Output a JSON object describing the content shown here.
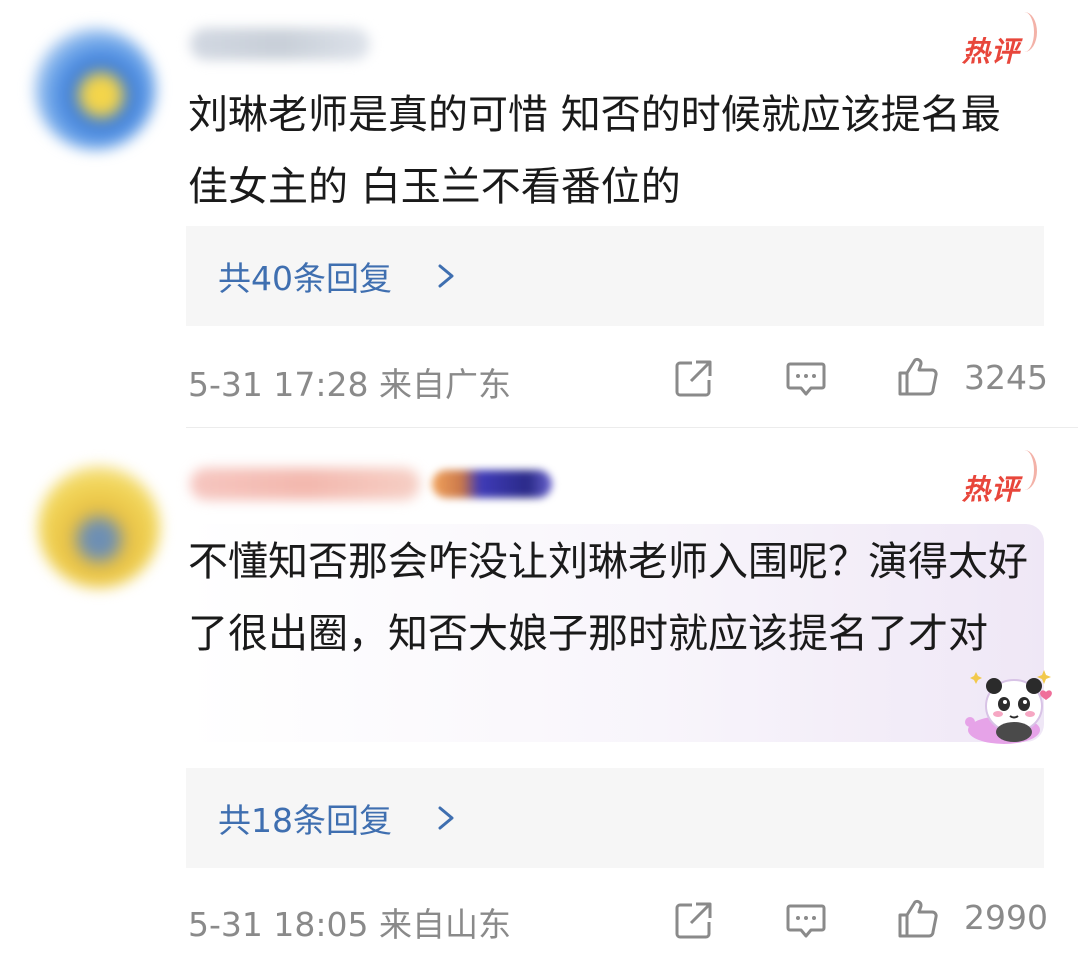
{
  "comments": [
    {
      "badge": "热评",
      "text": "刘琳老师是真的可惜 知否的时候就应该提名最佳女主的 白玉兰不看番位的",
      "replies_label": "共40条回复",
      "timestamp": "5-31 17:28",
      "location": "来自广东",
      "likes": "3245",
      "icons": [
        "share-icon",
        "comment-icon",
        "like-icon",
        "chevron-right-icon"
      ]
    },
    {
      "badge": "热评",
      "text": "不懂知否那会咋没让刘琳老师入围呢？演得太好了很出圈，知否大娘子那时就应该提名了才对",
      "replies_label": "共18条回复",
      "timestamp": "5-31 18:05",
      "location": "来自山东",
      "likes": "2990",
      "icons": [
        "share-icon",
        "comment-icon",
        "like-icon",
        "chevron-right-icon",
        "panda-sticker"
      ]
    }
  ],
  "colors": {
    "hot_badge": "#e8463b",
    "reply_link": "#3f6fb0",
    "meta_text": "#8a8a8a",
    "body_text": "#1a1a1a",
    "reply_box_bg": "#f6f6f6"
  }
}
